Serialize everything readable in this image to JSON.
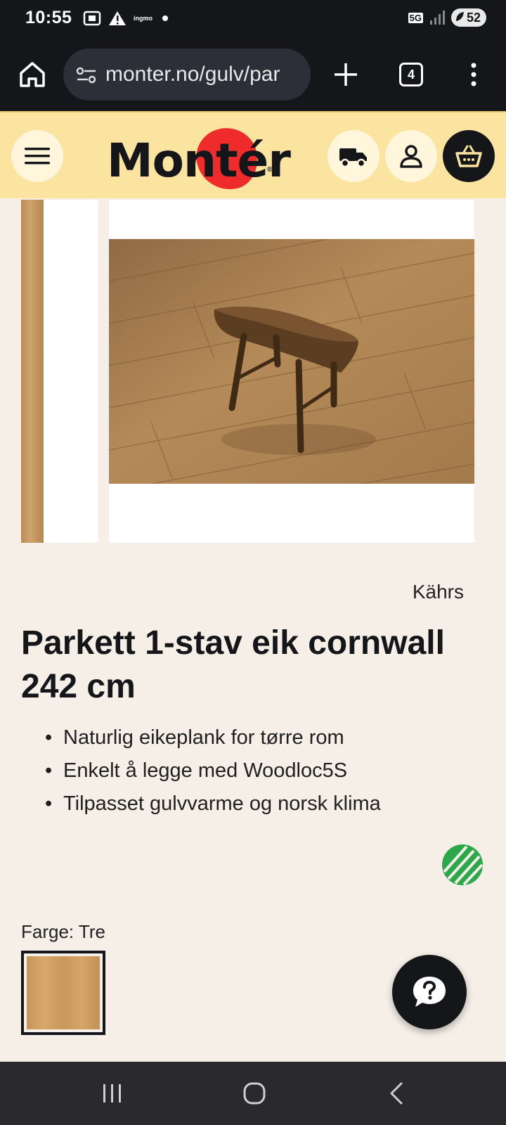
{
  "status_bar": {
    "time": "10:55",
    "small_label": "ingmo",
    "network": "5G",
    "battery": "52"
  },
  "browser": {
    "url": "monter.no/gulv/par",
    "tab_count": "4"
  },
  "header": {
    "logo_text": "Montér"
  },
  "product": {
    "brand": "Kährs",
    "title": "Parkett 1-stav eik cornwall 242 cm",
    "features": [
      "Naturlig eikeplank for tørre rom",
      "Enkelt å legge med Woodloc5S",
      "Tilpasset gulvvarme og norsk klima"
    ],
    "color_label": "Farge: Tre"
  },
  "colors": {
    "header_bg": "#fbe3a0",
    "page_bg": "#f5efe7",
    "logo_red": "#ef2b2b",
    "dark": "#15161a",
    "eco_green": "#2aa84a"
  }
}
